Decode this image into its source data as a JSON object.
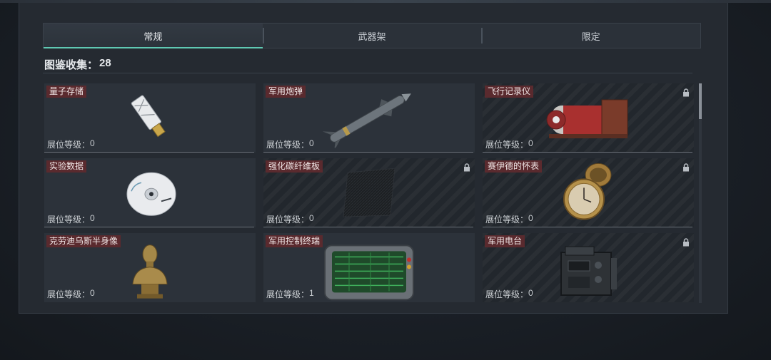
{
  "tabs": [
    {
      "label": "常规",
      "active": true
    },
    {
      "label": "武器架",
      "active": false
    },
    {
      "label": "限定",
      "active": false
    }
  ],
  "collection": {
    "label": "图鉴收集：",
    "count": "28"
  },
  "level_label": "展位等级：",
  "items": [
    {
      "name": "量子存储",
      "level": "0",
      "locked": false,
      "icon": "usb-drive-icon"
    },
    {
      "name": "军用炮弹",
      "level": "0",
      "locked": false,
      "icon": "missile-icon"
    },
    {
      "name": "飞行记录仪",
      "level": "0",
      "locked": true,
      "icon": "flight-recorder-icon"
    },
    {
      "name": "实验数据",
      "level": "0",
      "locked": false,
      "icon": "disc-icon"
    },
    {
      "name": "强化碳纤维板",
      "level": "0",
      "locked": true,
      "icon": "carbon-plate-icon"
    },
    {
      "name": "赛伊德的怀表",
      "level": "0",
      "locked": true,
      "icon": "pocket-watch-icon"
    },
    {
      "name": "克劳迪乌斯半身像",
      "level": "0",
      "locked": false,
      "icon": "bust-icon"
    },
    {
      "name": "军用控制终端",
      "level": "1",
      "locked": false,
      "icon": "control-terminal-icon"
    },
    {
      "name": "军用电台",
      "level": "0",
      "locked": true,
      "icon": "radio-icon"
    }
  ],
  "colors": {
    "accent": "#5fc9b3",
    "name_tag": "#5a2a2e",
    "panel": "#252a31"
  }
}
